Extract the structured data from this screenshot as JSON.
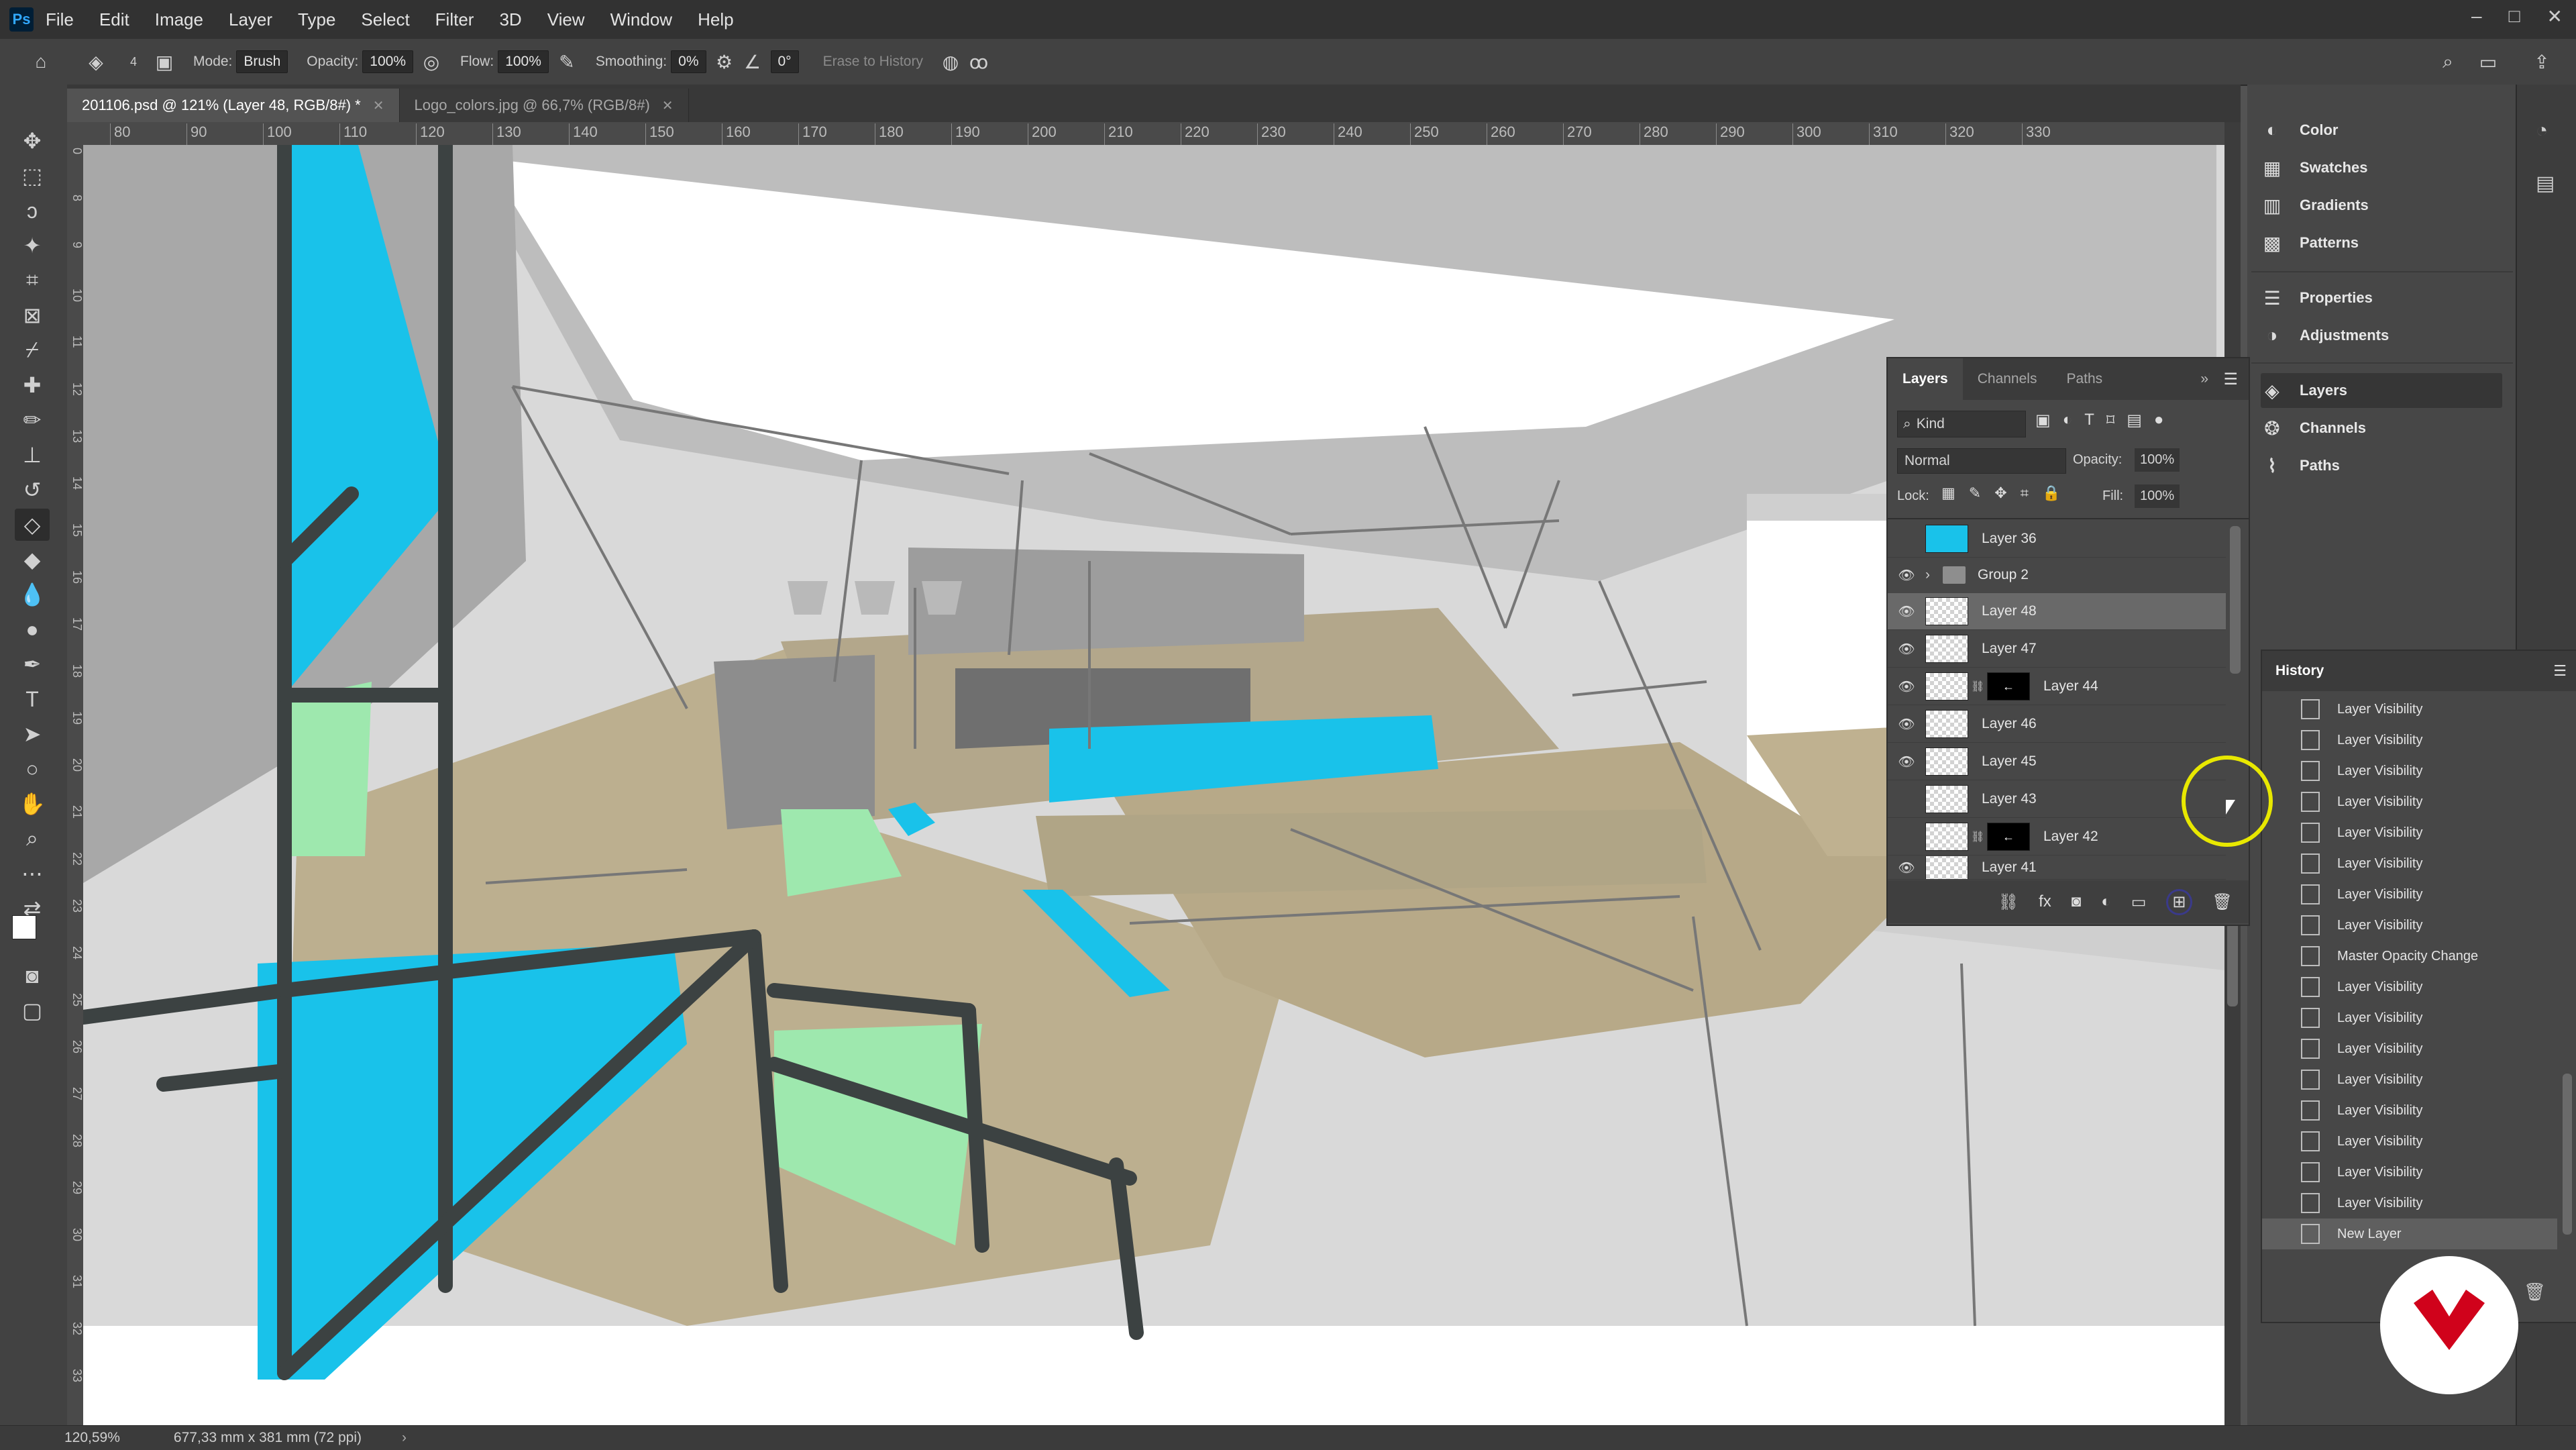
{
  "menu": [
    "File",
    "Edit",
    "Image",
    "Layer",
    "Type",
    "Select",
    "Filter",
    "3D",
    "View",
    "Window",
    "Help"
  ],
  "window_controls": [
    "–",
    "□",
    "✕"
  ],
  "options": {
    "brush_size": "4",
    "mode_label": "Mode:",
    "mode_value": "Brush",
    "opacity_label": "Opacity:",
    "opacity_value": "100%",
    "flow_label": "Flow:",
    "flow_value": "100%",
    "smoothing_label": "Smoothing:",
    "smoothing_value": "0%",
    "angle_value": "0°",
    "erase_history": "Erase to History"
  },
  "tabs": [
    {
      "label": "201106.psd @ 121% (Layer 48, RGB/8#) *"
    },
    {
      "label": "Logo_colors.jpg @ 66,7% (RGB/8#)"
    }
  ],
  "ruler_top": [
    "80",
    "90",
    "100",
    "110",
    "120",
    "130",
    "140",
    "150",
    "160",
    "170",
    "180",
    "190",
    "200",
    "210",
    "220",
    "230",
    "240",
    "250",
    "260",
    "270",
    "280",
    "290",
    "300",
    "310",
    "320",
    "330"
  ],
  "ruler_left": [
    "0",
    "8",
    "9",
    "10",
    "11",
    "12",
    "13",
    "14",
    "15",
    "16",
    "17",
    "18",
    "19",
    "20",
    "21",
    "22",
    "23",
    "24",
    "25",
    "26",
    "27",
    "28",
    "29",
    "30",
    "31",
    "32",
    "33"
  ],
  "status": {
    "zoom": "120,59%",
    "doc_size": "677,33 mm x 381 mm (72 ppi)"
  },
  "dock": {
    "color": "Color",
    "swatches": "Swatches",
    "gradients": "Gradients",
    "patterns": "Patterns",
    "properties": "Properties",
    "adjustments": "Adjustments",
    "layers": "Layers",
    "channels": "Channels",
    "paths": "Paths"
  },
  "layers_panel": {
    "tabs": [
      "Layers",
      "Channels",
      "Paths"
    ],
    "filter": "Kind",
    "blend_mode": "Normal",
    "opacity_label": "Opacity:",
    "opacity_value": "100%",
    "lock_label": "Lock:",
    "fill_label": "Fill:",
    "fill_value": "100%",
    "rows": [
      {
        "name": "Layer 36",
        "visible": false,
        "thumb": "cyan"
      },
      {
        "name": "Group 2",
        "visible": true,
        "thumb": "folder"
      },
      {
        "name": "Layer 48",
        "visible": true,
        "thumb": "transparent",
        "selected": true
      },
      {
        "name": "Layer 47",
        "visible": true,
        "thumb": "transparent"
      },
      {
        "name": "Layer 44",
        "visible": true,
        "thumb": "mask"
      },
      {
        "name": "Layer 46",
        "visible": true,
        "thumb": "transparent"
      },
      {
        "name": "Layer 45",
        "visible": true,
        "thumb": "transparent"
      },
      {
        "name": "Layer 43",
        "visible": false,
        "thumb": "transparent"
      },
      {
        "name": "Layer 42",
        "visible": false,
        "thumb": "mask"
      },
      {
        "name": "Layer 41",
        "visible": true,
        "thumb": "transparent"
      }
    ]
  },
  "history_panel": {
    "title": "History",
    "items": [
      "Layer Visibility",
      "Layer Visibility",
      "Layer Visibility",
      "Layer Visibility",
      "Layer Visibility",
      "Layer Visibility",
      "Layer Visibility",
      "Layer Visibility",
      "Master Opacity Change",
      "Layer Visibility",
      "Layer Visibility",
      "Layer Visibility",
      "Layer Visibility",
      "Layer Visibility",
      "Layer Visibility",
      "Layer Visibility",
      "Layer Visibility",
      "New Layer"
    ]
  },
  "colors": {
    "accent_cyan": "#19c2ea",
    "accent_green": "#9ee8ae",
    "floor_tan": "#b3a78b",
    "frame_dark": "#3c4242"
  }
}
